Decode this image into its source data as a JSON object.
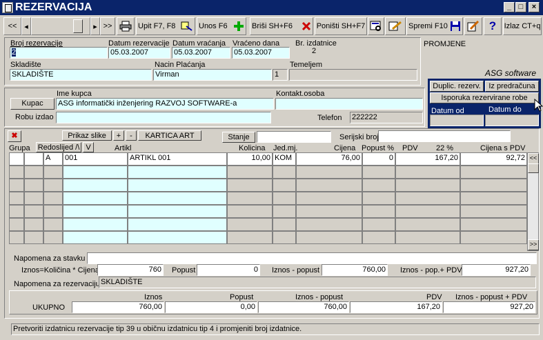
{
  "window": {
    "title": "REZERVACIJA"
  },
  "toolbar": {
    "first": "<<",
    "prev": "◂",
    "next": "▸",
    "last": ">>",
    "upit": "Upit F7, F8",
    "unos": "Unos F6",
    "brisi": "Briši  SH+F6",
    "ponisti": "Poništi SH+F7",
    "spremi": "Spremi F10",
    "izlaz": "Izlaz CT+q"
  },
  "header": {
    "broj_rezervacije_label": "Broj rezervacije",
    "broj_rezervacije": "2",
    "datum_rezervacije_label": "Datum rezervacije",
    "datum_rezervacije": "05.03.2007",
    "datum_vracanja_label": "Datum vraćanja",
    "datum_vracanja": "05.03.2007",
    "vraceno_dana_label": "Vraćeno dana",
    "vraceno_dana": "05.03.2007",
    "br_izdatnice_label": "Br. izdatnice",
    "br_izdatnice": "2",
    "skladiste_label": "Skladište",
    "skladiste": "SKLADIŠTE",
    "nacin_placanja_label": "Nacin Plaćanja",
    "nacin_placanja": "Virman",
    "nacin_code": "1",
    "temeljem_label": "Temeljem",
    "temeljem": "",
    "promjene": "PROMJENE"
  },
  "brand": "ASG software",
  "side": {
    "duplic": "Duplic. rezerv.",
    "iz_predracuna": "Iz predračuna",
    "isporuka": "Isporuka rezervirane robe",
    "datum_od": "Datum od",
    "datum_do": "Datum do"
  },
  "kupac": {
    "ime_label": "Ime kupca",
    "button": "Kupac",
    "ime": "ASG  informatički inženjering  RAZVOJ SOFTWARE-a",
    "kontakt_label": "Kontakt.osoba",
    "kontakt": "",
    "robu_izdao_label": "Robu izdao",
    "robu_izdao": "",
    "telefon_label": "Telefon",
    "telefon": "222222"
  },
  "items_toolbar": {
    "prikaz_slike": "Prikaz slike",
    "plus": "+",
    "minus": "-",
    "kartica": "KARTICA ART",
    "stanje": "Stanje",
    "serijski": "Serijski broj",
    "delete_x": "✖"
  },
  "columns": {
    "grupa": "Grupa",
    "redoslijed": "Redoslijed /\\",
    "v": "V",
    "artikl": "Artikl",
    "kolicina": "Kolicina",
    "jed": "Jed.mj.",
    "cijena": "Cijena",
    "popust": "Popust %",
    "pdv": "PDV",
    "pdv_pct": "22 %",
    "cijena_s_pdv": "Cijena s PDV"
  },
  "rows": [
    {
      "grupa": "",
      "a": "",
      "b": "A",
      "sifra": "001",
      "naziv": "ARTIKL 001",
      "kolicina": "10,00",
      "jed": "KOM",
      "cijena": "76,00",
      "popust": "0",
      "pdv": "167,20",
      "cijena_pdv": "92,72"
    }
  ],
  "napomena_stavka_label": "Napomena za stavku",
  "napomena_stavka": "",
  "calc": {
    "iznos_label": "Iznos=Količina * Cijena",
    "iznos": "760",
    "popust_label": "Popust",
    "popust": "0",
    "iznos_popust_label": "Iznos - popust",
    "iznos_popust": "760,00",
    "iznos_pop_pdv_label": "Iznos - pop.+ PDV",
    "iznos_pop_pdv": "927,20"
  },
  "napomena_rez_label": "Napomena za rezervaciju",
  "napomena_rez": "SKLADIŠTE",
  "ukupno": {
    "label": "UKUPNO",
    "iznos_label": "Iznos",
    "iznos": "760,00",
    "popust_label": "Popust",
    "popust": "0,00",
    "iznos_popust_label": "Iznos - popust",
    "iznos_popust": "760,00",
    "pdv_label": "PDV",
    "pdv": "167,20",
    "iznos_pop_pdv_label": "Iznos - popust + PDV",
    "iznos_pop_pdv": "927,20"
  },
  "status": "Pretvoriti izdatnicu rezervacije tip 39 u običnu izdatnicu tip 4 i promjeniti broj izdatnice.",
  "scroll": {
    "up": "<<",
    "down": ">>"
  }
}
